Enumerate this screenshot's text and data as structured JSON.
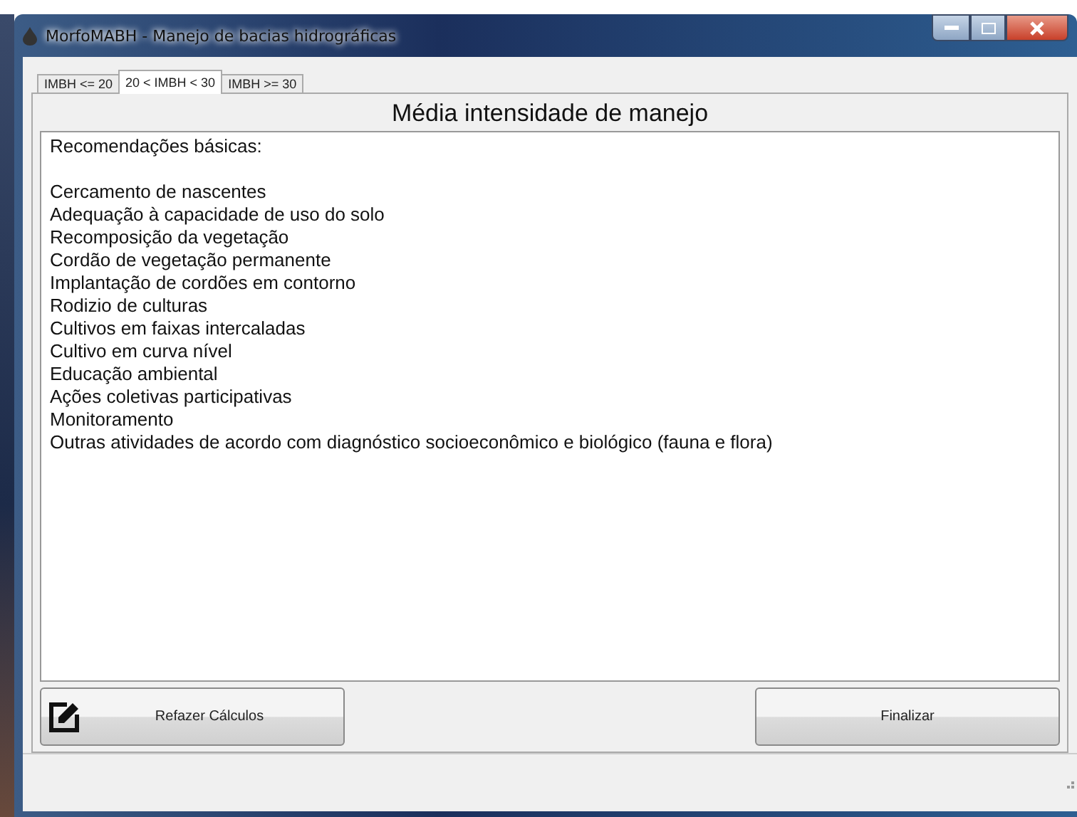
{
  "window": {
    "title": "MorfoMABH - Manejo de bacias hidrográficas"
  },
  "tabs": [
    {
      "label": "IMBH <= 20",
      "selected": false
    },
    {
      "label": "20 < IMBH < 30",
      "selected": true
    },
    {
      "label": "IMBH >= 30",
      "selected": false
    }
  ],
  "panel": {
    "heading": "Média intensidade de manejo",
    "intro": "Recomendações básicas:",
    "text_lines": [
      "Cercamento de nascentes",
      "Adequação à capacidade de uso do solo",
      "Recomposição da vegetação",
      "Cordão de vegetação permanente",
      "Implantação de cordões em contorno",
      "Rodizio de culturas",
      "Cultivos em faixas intercaladas",
      "Cultivo em curva nível",
      "Educação ambiental",
      "Ações coletivas participativas",
      "Monitoramento",
      "Outras atividades de acordo com diagnóstico socioeconômico e biológico (fauna e flora)"
    ]
  },
  "buttons": [
    {
      "label": "Refazer Cálculos",
      "kind": "icon"
    },
    {
      "label": "Finalizar",
      "kind": "plain"
    }
  ]
}
